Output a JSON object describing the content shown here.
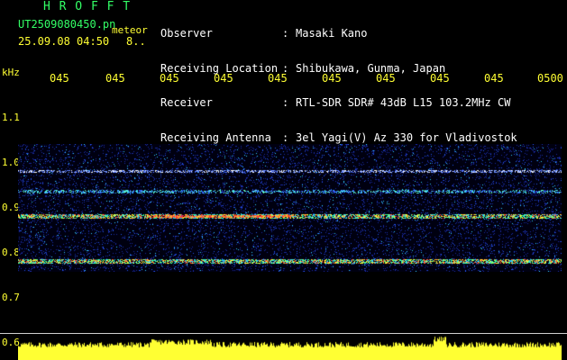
{
  "header": {
    "app_title": "H R O F F T",
    "filename": "UT2509080450.pn",
    "filename_suffix": "meteor",
    "datetime": "25.09.08 04:50",
    "datetime_suffix": "8..",
    "fields": [
      {
        "label": "Observer",
        "value": "Masaki Kano"
      },
      {
        "label": "Receiving Location",
        "value": "Shibukawa, Gunma, Japan"
      },
      {
        "label": "Receiver",
        "value": "RTL-SDR SDR# 43dB L15 103.2MHz CW"
      },
      {
        "label": "Receiving Antenna",
        "value": "3el Yagi(V) Az 330 for Vladivostok"
      }
    ],
    "separator": ":"
  },
  "axis": {
    "unit": "kHz",
    "y_ticks": [
      "1.1",
      "1.0",
      "0.9",
      "0.8",
      "0.7",
      "0.6"
    ],
    "x_ticks": [
      "045",
      "045",
      "045",
      "045",
      "045",
      "045",
      "045",
      "045",
      "045",
      "0500"
    ]
  },
  "spectrogram": {
    "band_freqs_khz": [
      0.98,
      0.935,
      0.88,
      0.78
    ],
    "band_colors": [
      "#3355ff",
      "#33ff99",
      "#ff3333",
      "#ffff33"
    ]
  },
  "colors": {
    "label_green": "#33ff66",
    "label_yellow": "#ffff33",
    "text_white": "#ffffff",
    "background": "#000000"
  }
}
